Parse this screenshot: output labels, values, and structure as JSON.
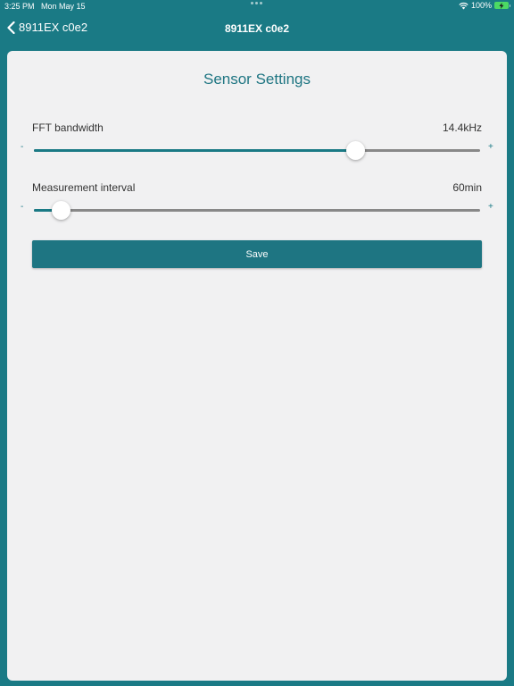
{
  "status_bar": {
    "time": "3:25 PM",
    "date": "Mon May 15",
    "battery_percent": "100%",
    "icons": [
      "wifi-icon",
      "battery-icon",
      "charging-bolt-icon"
    ]
  },
  "nav": {
    "back_label": "8911EX c0e2",
    "title": "8911EX c0e2",
    "back_icon": "chevron-left-icon"
  },
  "page": {
    "title": "Sensor Settings"
  },
  "settings": {
    "fft": {
      "label": "FFT bandwidth",
      "value": "14.4kHz",
      "minus": "-",
      "plus": "+",
      "slider_fraction": 0.72
    },
    "interval": {
      "label": "Measurement interval",
      "value": "60min",
      "minus": "-",
      "plus": "+",
      "slider_fraction": 0.06
    }
  },
  "save_label": "Save",
  "colors": {
    "background": "#1a7a85",
    "panel": "#f1f1f2",
    "accent": "#1e7582",
    "track": "#888888"
  }
}
